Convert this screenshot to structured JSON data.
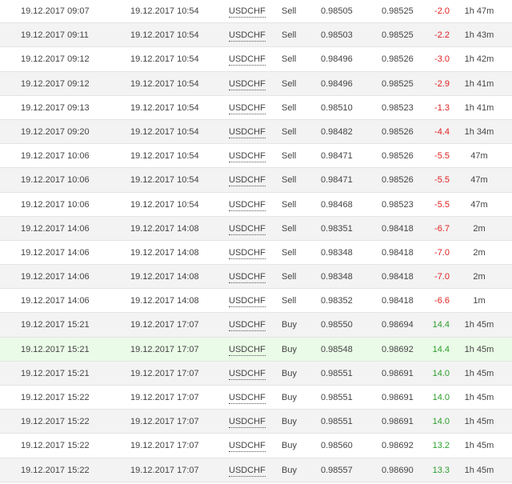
{
  "colors": {
    "loss": "#e02020",
    "profit": "#2a9d2a",
    "row_alt": "#f3f3f3",
    "row_highlight": "#eafbe7"
  },
  "trades": [
    {
      "open_time": "19.12.2017 09:07",
      "close_time": "19.12.2017 10:54",
      "symbol": "USDCHF",
      "type": "Sell",
      "open_price": "0.98505",
      "close_price": "0.98525",
      "profit": "-2.0",
      "duration": "1h 47m"
    },
    {
      "open_time": "19.12.2017 09:11",
      "close_time": "19.12.2017 10:54",
      "symbol": "USDCHF",
      "type": "Sell",
      "open_price": "0.98503",
      "close_price": "0.98525",
      "profit": "-2.2",
      "duration": "1h 43m"
    },
    {
      "open_time": "19.12.2017 09:12",
      "close_time": "19.12.2017 10:54",
      "symbol": "USDCHF",
      "type": "Sell",
      "open_price": "0.98496",
      "close_price": "0.98526",
      "profit": "-3.0",
      "duration": "1h 42m"
    },
    {
      "open_time": "19.12.2017 09:12",
      "close_time": "19.12.2017 10:54",
      "symbol": "USDCHF",
      "type": "Sell",
      "open_price": "0.98496",
      "close_price": "0.98525",
      "profit": "-2.9",
      "duration": "1h 41m"
    },
    {
      "open_time": "19.12.2017 09:13",
      "close_time": "19.12.2017 10:54",
      "symbol": "USDCHF",
      "type": "Sell",
      "open_price": "0.98510",
      "close_price": "0.98523",
      "profit": "-1.3",
      "duration": "1h 41m"
    },
    {
      "open_time": "19.12.2017 09:20",
      "close_time": "19.12.2017 10:54",
      "symbol": "USDCHF",
      "type": "Sell",
      "open_price": "0.98482",
      "close_price": "0.98526",
      "profit": "-4.4",
      "duration": "1h 34m"
    },
    {
      "open_time": "19.12.2017 10:06",
      "close_time": "19.12.2017 10:54",
      "symbol": "USDCHF",
      "type": "Sell",
      "open_price": "0.98471",
      "close_price": "0.98526",
      "profit": "-5.5",
      "duration": "47m"
    },
    {
      "open_time": "19.12.2017 10:06",
      "close_time": "19.12.2017 10:54",
      "symbol": "USDCHF",
      "type": "Sell",
      "open_price": "0.98471",
      "close_price": "0.98526",
      "profit": "-5.5",
      "duration": "47m"
    },
    {
      "open_time": "19.12.2017 10:06",
      "close_time": "19.12.2017 10:54",
      "symbol": "USDCHF",
      "type": "Sell",
      "open_price": "0.98468",
      "close_price": "0.98523",
      "profit": "-5.5",
      "duration": "47m"
    },
    {
      "open_time": "19.12.2017 14:06",
      "close_time": "19.12.2017 14:08",
      "symbol": "USDCHF",
      "type": "Sell",
      "open_price": "0.98351",
      "close_price": "0.98418",
      "profit": "-6.7",
      "duration": "2m"
    },
    {
      "open_time": "19.12.2017 14:06",
      "close_time": "19.12.2017 14:08",
      "symbol": "USDCHF",
      "type": "Sell",
      "open_price": "0.98348",
      "close_price": "0.98418",
      "profit": "-7.0",
      "duration": "2m"
    },
    {
      "open_time": "19.12.2017 14:06",
      "close_time": "19.12.2017 14:08",
      "symbol": "USDCHF",
      "type": "Sell",
      "open_price": "0.98348",
      "close_price": "0.98418",
      "profit": "-7.0",
      "duration": "2m"
    },
    {
      "open_time": "19.12.2017 14:06",
      "close_time": "19.12.2017 14:08",
      "symbol": "USDCHF",
      "type": "Sell",
      "open_price": "0.98352",
      "close_price": "0.98418",
      "profit": "-6.6",
      "duration": "1m"
    },
    {
      "open_time": "19.12.2017 15:21",
      "close_time": "19.12.2017 17:07",
      "symbol": "USDCHF",
      "type": "Buy",
      "open_price": "0.98550",
      "close_price": "0.98694",
      "profit": "14.4",
      "duration": "1h 45m"
    },
    {
      "open_time": "19.12.2017 15:21",
      "close_time": "19.12.2017 17:07",
      "symbol": "USDCHF",
      "type": "Buy",
      "open_price": "0.98548",
      "close_price": "0.98692",
      "profit": "14.4",
      "duration": "1h 45m"
    },
    {
      "open_time": "19.12.2017 15:21",
      "close_time": "19.12.2017 17:07",
      "symbol": "USDCHF",
      "type": "Buy",
      "open_price": "0.98551",
      "close_price": "0.98691",
      "profit": "14.0",
      "duration": "1h 45m"
    },
    {
      "open_time": "19.12.2017 15:22",
      "close_time": "19.12.2017 17:07",
      "symbol": "USDCHF",
      "type": "Buy",
      "open_price": "0.98551",
      "close_price": "0.98691",
      "profit": "14.0",
      "duration": "1h 45m"
    },
    {
      "open_time": "19.12.2017 15:22",
      "close_time": "19.12.2017 17:07",
      "symbol": "USDCHF",
      "type": "Buy",
      "open_price": "0.98551",
      "close_price": "0.98691",
      "profit": "14.0",
      "duration": "1h 45m"
    },
    {
      "open_time": "19.12.2017 15:22",
      "close_time": "19.12.2017 17:07",
      "symbol": "USDCHF",
      "type": "Buy",
      "open_price": "0.98560",
      "close_price": "0.98692",
      "profit": "13.2",
      "duration": "1h 45m"
    },
    {
      "open_time": "19.12.2017 15:22",
      "close_time": "19.12.2017 17:07",
      "symbol": "USDCHF",
      "type": "Buy",
      "open_price": "0.98557",
      "close_price": "0.98690",
      "profit": "13.3",
      "duration": "1h 45m"
    }
  ]
}
